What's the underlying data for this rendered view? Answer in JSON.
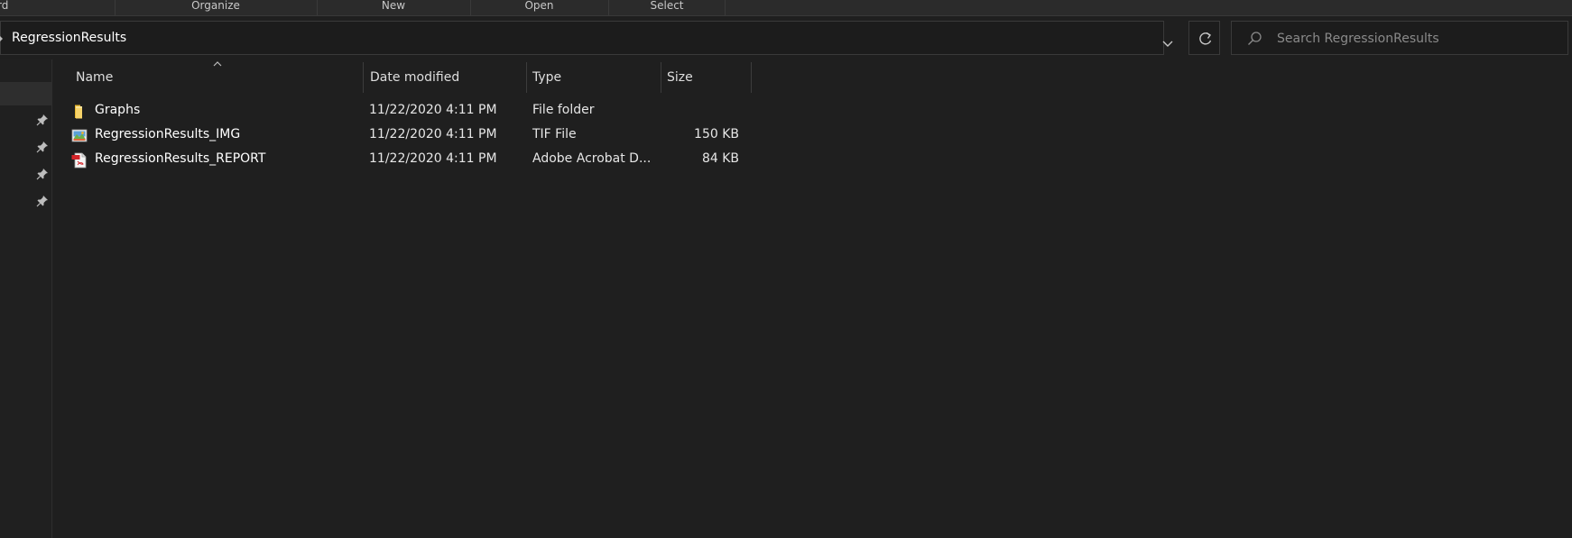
{
  "ribbon": {
    "groups": [
      "rd",
      "Organize",
      "New",
      "Open",
      "Select"
    ]
  },
  "address": {
    "path": "RegressionResults"
  },
  "search": {
    "placeholder": "Search RegressionResults"
  },
  "columns": {
    "name": "Name",
    "date": "Date modified",
    "type": "Type",
    "size": "Size"
  },
  "files": [
    {
      "name": "Graphs",
      "date": "11/22/2020 4:11 PM",
      "type": "File folder",
      "size": "",
      "icon": "folder-icon"
    },
    {
      "name": "RegressionResults_IMG",
      "date": "11/22/2020 4:11 PM",
      "type": "TIF File",
      "size": "150 KB",
      "icon": "tif-image-icon"
    },
    {
      "name": "RegressionResults_REPORT",
      "date": "11/22/2020 4:11 PM",
      "type": "Adobe Acrobat D...",
      "size": "84 KB",
      "icon": "pdf-file-icon"
    }
  ],
  "colors": {
    "background": "#202020",
    "folder": "#f3c74a",
    "pdf": "#d4252a"
  }
}
